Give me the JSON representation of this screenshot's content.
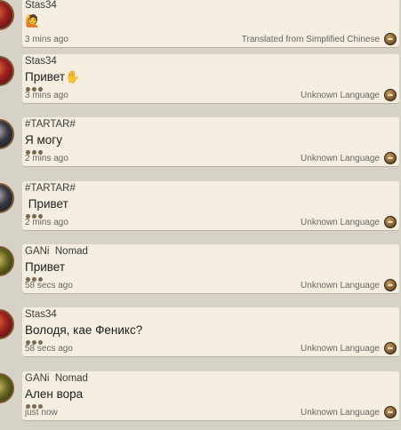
{
  "messages": [
    {
      "name": "Stas34",
      "text": "🙋",
      "time": "3 mins ago",
      "lang": "Translated from Simplified Chinese",
      "avatar": "red",
      "dots": false
    },
    {
      "name": "Stas34",
      "text": "Привет✋",
      "time": "3 mins ago",
      "lang": "Unknown Language",
      "avatar": "red",
      "dots": true
    },
    {
      "name": "#TARTAR#",
      "text": "Я могу",
      "time": "2 mins ago",
      "lang": "Unknown Language",
      "avatar": "dark",
      "dots": true
    },
    {
      "name": "#TARTAR#",
      "text": " Привет",
      "time": "2 mins ago",
      "lang": "Unknown Language",
      "avatar": "dark",
      "dots": true
    },
    {
      "name": "GANi  Nomad",
      "text": "Привет",
      "time": "58 secs ago",
      "lang": "Unknown Language",
      "avatar": "gold",
      "dots": true
    },
    {
      "name": "Stas34",
      "text": "Володя, кае Феникс?",
      "time": "58 secs ago",
      "lang": "Unknown Language",
      "avatar": "red",
      "dots": true
    },
    {
      "name": "GANi  Nomad",
      "text": "Ален вора",
      "time": "just now",
      "lang": "Unknown Language",
      "avatar": "gold",
      "dots": true
    }
  ],
  "icons": {
    "translate": "translate-icon",
    "more": "more-dots-icon",
    "avatar": "avatar-icon"
  }
}
